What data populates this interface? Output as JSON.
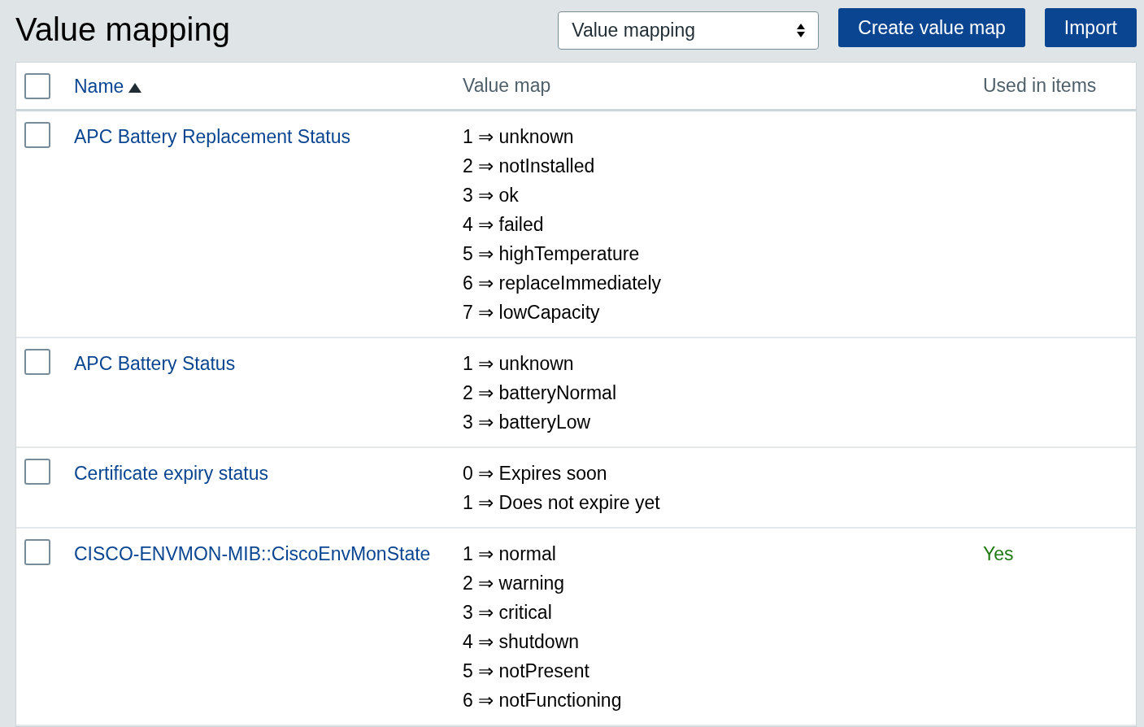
{
  "page_title": "Value mapping",
  "view_select": {
    "value": "Value mapping"
  },
  "buttons": [
    "Create value map",
    "Import"
  ],
  "table": {
    "columns": [
      {
        "label": "Name",
        "sortable": true,
        "sorted": true
      },
      {
        "label": "Value map",
        "sortable": false
      },
      {
        "label": "Used in items",
        "sortable": false
      }
    ],
    "header_checkbox": {
      "checked": false
    },
    "rows": [
      {
        "name": "APC Battery Replacement Status",
        "checked": false,
        "mappings": [
          "1 ⇒ unknown",
          "2 ⇒ notInstalled",
          "3 ⇒ ok",
          "4 ⇒ failed",
          "5 ⇒ highTemperature",
          "6 ⇒ replaceImmediately",
          "7 ⇒ lowCapacity"
        ]
      },
      {
        "name": "APC Battery Status",
        "checked": false,
        "mappings": [
          "1 ⇒ unknown",
          "2 ⇒ batteryNormal",
          "3 ⇒ batteryLow"
        ]
      },
      {
        "name": "Certificate expiry status",
        "checked": false,
        "mappings": [
          "0 ⇒ Expires soon",
          "1 ⇒ Does not expire yet"
        ]
      },
      {
        "name": "CISCO-ENVMON-MIB::CiscoEnvMonState",
        "checked": false,
        "mappings": [
          "1 ⇒ normal",
          "2 ⇒ warning",
          "3 ⇒ critical",
          "4 ⇒ shutdown",
          "5 ⇒ notPresent",
          "6 ⇒ notFunctioning"
        ],
        "used_in_items": "Yes"
      }
    ]
  }
}
